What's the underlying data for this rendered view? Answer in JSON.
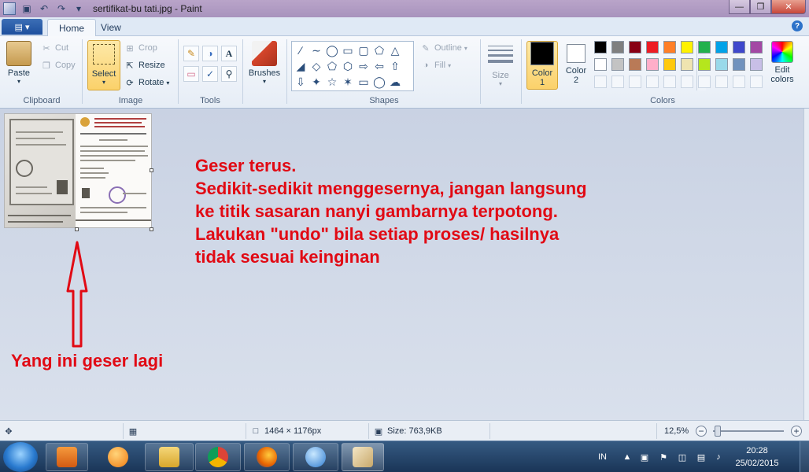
{
  "window": {
    "title": "sertifikat-bu tati.jpg - Paint",
    "controls": [
      "minimize",
      "maximize",
      "close"
    ]
  },
  "tabs": {
    "file_label": "",
    "items": [
      {
        "label": "Home",
        "active": true
      },
      {
        "label": "View",
        "active": false
      }
    ]
  },
  "ribbon": {
    "clipboard": {
      "group": "Clipboard",
      "paste": "Paste",
      "cut": "Cut",
      "copy": "Copy"
    },
    "image": {
      "group": "Image",
      "select": "Select",
      "crop": "Crop",
      "resize": "Resize",
      "rotate": "Rotate"
    },
    "tools": {
      "group": "Tools"
    },
    "brushes": {
      "label": "Brushes"
    },
    "shapes": {
      "group": "Shapes",
      "outline": "Outline",
      "fill": "Fill"
    },
    "size": {
      "label": "Size"
    },
    "colors": {
      "group": "Colors",
      "color1": "Color\n1",
      "color1_line1": "Color",
      "color1_line2": "1",
      "color2_line1": "Color",
      "color2_line2": "2",
      "color1_value": "#000000",
      "color2_value": "#ffffff",
      "edit_line1": "Edit",
      "edit_line2": "colors",
      "palette_row1": [
        "#000000",
        "#7f7f7f",
        "#880015",
        "#ed1c24",
        "#ff7f27",
        "#fff200",
        "#22b14c",
        "#00a2e8",
        "#3f48cc",
        "#a349a4"
      ],
      "palette_row2": [
        "#ffffff",
        "#c3c3c3",
        "#b97a57",
        "#ffaec9",
        "#ffc90e",
        "#efe4b0",
        "#b5e61d",
        "#99d9ea",
        "#7092be",
        "#c8bfe7"
      ]
    }
  },
  "annotations": {
    "instructions": [
      "Geser terus.",
      "Sedikit-sedikit menggesernya, jangan langsung",
      "ke titik sasaran nanyi gambarnya terpotong.",
      "Lakukan \"undo\" bila setiap proses/ hasilnya",
      "tidak sesuai keinginan"
    ],
    "arrow_label": "Yang ini geser lagi",
    "color": "#e10a14"
  },
  "status": {
    "dimensions": "1464 × 1176px",
    "size": "Size: 763,9KB",
    "zoom": "12,5%"
  },
  "taskbar": {
    "language": "IN",
    "time": "20:28",
    "date": "25/02/2015"
  }
}
